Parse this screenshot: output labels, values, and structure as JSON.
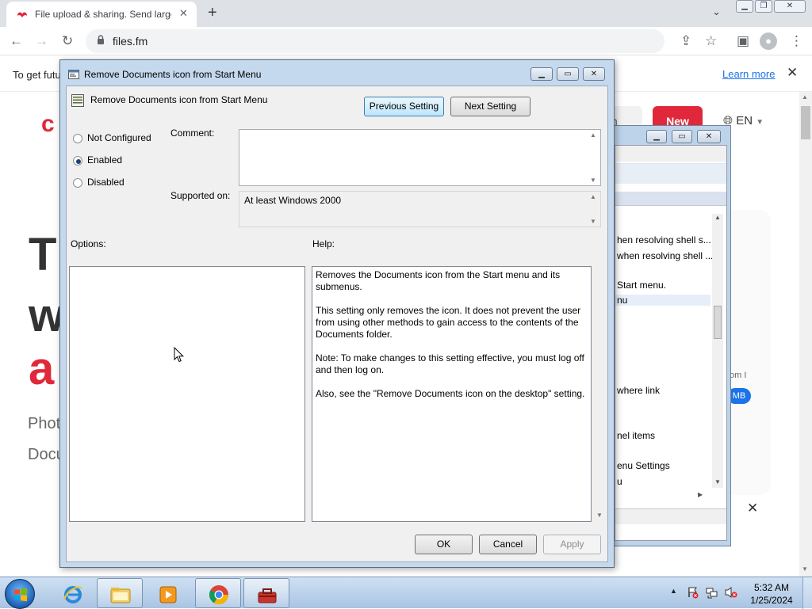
{
  "browser": {
    "tab_title": "File upload & sharing. Send large files",
    "url": "files.fm",
    "new_tab": "+",
    "tab_close": "✕"
  },
  "page": {
    "infobar_text": "To get futu",
    "learn_more": "Learn more",
    "signin_fragment": "t in",
    "new_button": "New",
    "language": "EN",
    "hero_line1": "T",
    "hero_line2": "w",
    "hero_line3": "a",
    "sub_line1": "Phot",
    "sub_line2": "Docu",
    "badge_mb": "MB",
    "om_fragment": "om I"
  },
  "bg_window": {
    "rows": [
      "hen resolving shell s...",
      "when resolving shell ...",
      "Start menu.",
      "nu",
      "where link",
      "nel items",
      "enu Settings",
      "u"
    ]
  },
  "dialog": {
    "title": "Remove Documents icon from Start Menu",
    "setting_name": "Remove Documents icon from Start Menu",
    "previous_setting": "Previous Setting",
    "next_setting": "Next Setting",
    "radio_not_configured": "Not Configured",
    "radio_enabled": "Enabled",
    "radio_disabled": "Disabled",
    "selected": "Enabled",
    "comment_label": "Comment:",
    "comment_value": "",
    "supported_label": "Supported on:",
    "supported_value": "At least Windows 2000",
    "options_label": "Options:",
    "help_label": "Help:",
    "help": [
      "Removes the Documents icon from the Start menu and its submenus.",
      "This setting only removes the icon. It does not prevent the user from using other methods to gain access to the contents of the Documents folder.",
      "Note: To make changes to this setting effective, you must log off and then log on.",
      "Also, see the \"Remove Documents icon on the desktop\" setting."
    ],
    "ok": "OK",
    "cancel": "Cancel",
    "apply": "Apply"
  },
  "taskbar": {
    "time": "5:32 AM",
    "date": "1/25/2024",
    "items": [
      "start-orb",
      "internet-explorer-icon",
      "file-explorer-icon",
      "media-player-icon",
      "chrome-icon",
      "toolbox-icon"
    ]
  },
  "colors": {
    "brand_red": "#e0283a",
    "link_blue": "#1a73e8",
    "dialog_frame": "#c4d8ee"
  }
}
